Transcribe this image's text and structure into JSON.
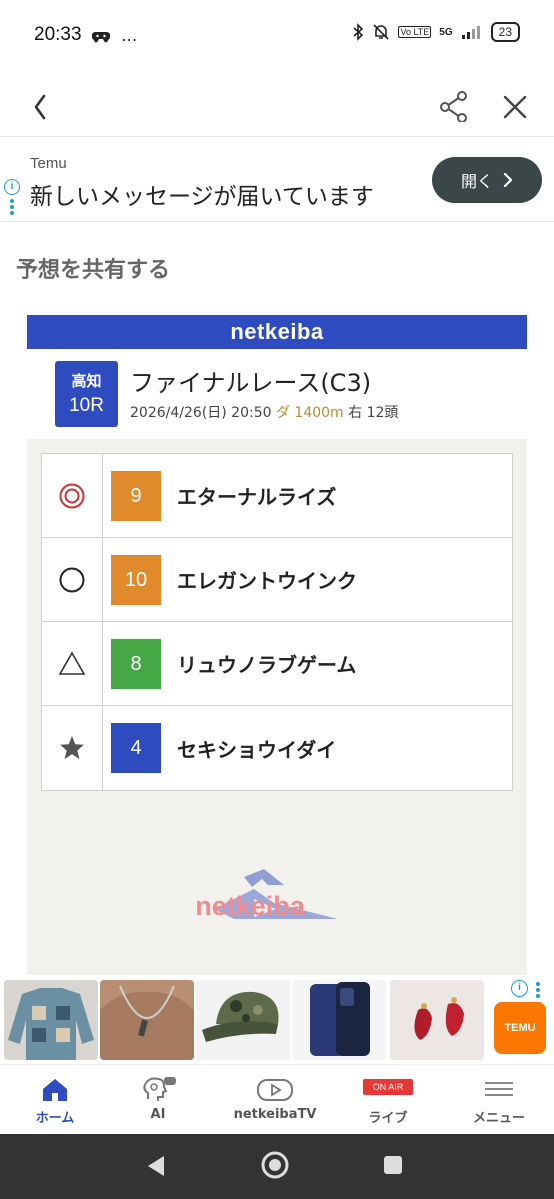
{
  "status_bar": {
    "time": "20:33",
    "left_extra": "…",
    "network_label": "5G",
    "volte_label": "Vo LTE",
    "battery": "23"
  },
  "ad": {
    "brand": "Temu",
    "message": "新しいメッセージが届いています",
    "button_label": "開く"
  },
  "page": {
    "heading": "予想を共有する"
  },
  "card": {
    "site_name": "netkeiba",
    "venue": "高知",
    "race_number": "10R",
    "race_name": "ファイナルレース(C3)",
    "date_time": "2026/4/26(日) 20:50",
    "course": "ダ 1400m",
    "direction_runners": "右 12頭",
    "picks": [
      {
        "mark": "double-circle",
        "number": "9",
        "name": "エターナルライズ",
        "color": "#e08a2c"
      },
      {
        "mark": "circle",
        "number": "10",
        "name": "エレガントウインク",
        "color": "#e08a2c"
      },
      {
        "mark": "triangle",
        "number": "8",
        "name": "リュウノラブゲーム",
        "color": "#45a844"
      },
      {
        "mark": "star",
        "number": "4",
        "name": "セキショウイダイ",
        "color": "#2e4bbf"
      }
    ],
    "watermark_text": "netkeiba"
  },
  "product_strip": {
    "brand": "TEMU",
    "products": [
      "sweater-thumbnail",
      "necklace-thumbnail",
      "camo-cap-thumbnail",
      "phone-case-thumbnail",
      "earrings-thumbnail"
    ]
  },
  "bottom_nav": {
    "items": [
      {
        "label": "ホーム",
        "icon": "home-icon"
      },
      {
        "label": "AI",
        "icon": "ai-brain-icon"
      },
      {
        "label": "netkeibaTV",
        "icon": "tv-play-icon"
      },
      {
        "label": "ライブ",
        "icon": "live-onair-icon",
        "badge": "ON AIR"
      },
      {
        "label": "メニュー",
        "icon": "menu-icon"
      }
    ]
  },
  "colors": {
    "brand_blue": "#2e4bbf",
    "ad_button": "#3a4648",
    "mark_red": "#d32f2f",
    "watermark_pink": "#f08c8f"
  }
}
